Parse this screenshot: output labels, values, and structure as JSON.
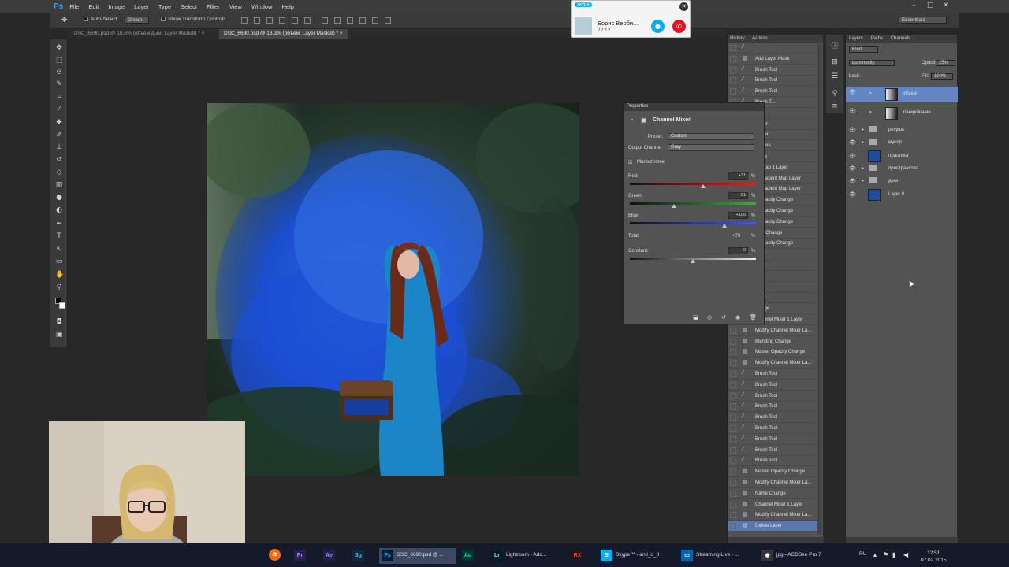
{
  "app": {
    "logo": "Ps",
    "menu": [
      "File",
      "Edit",
      "Image",
      "Layer",
      "Type",
      "Select",
      "Filter",
      "View",
      "Window",
      "Help"
    ],
    "window_controls": [
      "–",
      "□",
      "✕"
    ]
  },
  "options": {
    "auto_select_label": "Auto-Select",
    "auto_select_value": "Group",
    "show_transform_label": "Show Transform Controls",
    "workspace": "Essentials"
  },
  "tabs": [
    {
      "label": "DSC_6690.psd @ 18,6% (объем дым, Layer Mask/8) *",
      "close": "×",
      "active": false
    },
    {
      "label": "DSC_6690.psd @ 18,3% (объем, Layer Mask/8) *",
      "close": "×",
      "active": true
    }
  ],
  "skype": {
    "logo": "skype",
    "caller": "Борис Верби...",
    "duration": "22:12"
  },
  "history": {
    "tabs": [
      "History",
      "Actions"
    ],
    "items": [
      {
        "label": "",
        "icon": "brush"
      },
      {
        "label": "Add Layer Mask",
        "icon": "doc"
      },
      {
        "label": "Brush Tool",
        "icon": "brush"
      },
      {
        "label": "Brush Tool",
        "icon": "brush"
      },
      {
        "label": "Brush Tool",
        "icon": "brush"
      },
      {
        "label": "Brush T...",
        "icon": "brush"
      },
      {
        "label": "",
        "icon": "doc"
      },
      {
        "label": "...rder",
        "icon": "doc"
      },
      {
        "label": "...ayer",
        "icon": "doc"
      },
      {
        "label": "...ayers",
        "icon": "doc"
      },
      {
        "label": "...nge",
        "icon": "doc"
      },
      {
        "label": "...t Map 1 Layer",
        "icon": "doc"
      },
      {
        "label": "...Gradient Map Layer",
        "icon": "doc"
      },
      {
        "label": "...Gradient Map Layer",
        "icon": "doc"
      },
      {
        "label": "...Opacity Change",
        "icon": "doc"
      },
      {
        "label": "...Opacity Change",
        "icon": "doc"
      },
      {
        "label": "...Opacity Change",
        "icon": "doc"
      },
      {
        "label": "...ge Change",
        "icon": "doc"
      },
      {
        "label": "...Opacity Change",
        "icon": "doc"
      },
      {
        "label": "...ool",
        "icon": "brush"
      },
      {
        "label": "...ool",
        "icon": "brush"
      },
      {
        "label": "...ool",
        "icon": "brush"
      },
      {
        "label": "...ool",
        "icon": "brush"
      },
      {
        "label": "...ool",
        "icon": "brush"
      },
      {
        "label": "...ange",
        "icon": "doc"
      },
      {
        "label": "Channel Mixer 1 Layer",
        "icon": "doc"
      },
      {
        "label": "Modify Channel Mixer La...",
        "icon": "doc"
      },
      {
        "label": "Blending Change",
        "icon": "doc"
      },
      {
        "label": "Master Opacity Change",
        "icon": "doc"
      },
      {
        "label": "Modify Channel Mixer La...",
        "icon": "doc"
      },
      {
        "label": "Brush Tool",
        "icon": "brush"
      },
      {
        "label": "Brush Tool",
        "icon": "brush"
      },
      {
        "label": "Brush Tool",
        "icon": "brush"
      },
      {
        "label": "Brush Tool",
        "icon": "brush"
      },
      {
        "label": "Brush Tool",
        "icon": "brush"
      },
      {
        "label": "Brush Tool",
        "icon": "brush"
      },
      {
        "label": "Brush Tool",
        "icon": "brush"
      },
      {
        "label": "Brush Tool",
        "icon": "brush"
      },
      {
        "label": "Brush Tool",
        "icon": "brush"
      },
      {
        "label": "Master Opacity Change",
        "icon": "doc"
      },
      {
        "label": "Modify Channel Mixer La...",
        "icon": "doc"
      },
      {
        "label": "Name Change",
        "icon": "doc"
      },
      {
        "label": "Channel Mixer 1 Layer",
        "icon": "doc"
      },
      {
        "label": "Modify Channel Mixer La...",
        "icon": "doc"
      },
      {
        "label": "Delete Layer",
        "icon": "doc",
        "selected": true
      }
    ]
  },
  "layers": {
    "tabs": [
      "Layers",
      "Paths",
      "Channels"
    ],
    "filter": "Kind",
    "blend_mode": "Luminosity",
    "opacity_label": "Opacity:",
    "opacity_value": "25%",
    "lock_label": "Lock:",
    "fill_label": "Fill:",
    "fill_value": "100%",
    "items": [
      {
        "name": "объем",
        "kind": "adjust",
        "selected": true
      },
      {
        "name": "тонирование",
        "kind": "adjust"
      },
      {
        "name": "ретушь",
        "kind": "folder"
      },
      {
        "name": "мусор",
        "kind": "folder"
      },
      {
        "name": "пластика",
        "kind": "image"
      },
      {
        "name": "пространство",
        "kind": "folder"
      },
      {
        "name": "дым",
        "kind": "folder"
      },
      {
        "name": "Layer 0",
        "kind": "image"
      }
    ]
  },
  "properties": {
    "header": "Properties",
    "title": "Channel Mixer",
    "preset_label": "Preset:",
    "preset_value": "Custom",
    "output_label": "Output Channel:",
    "output_value": "Gray",
    "monochrome_label": "Monochrome",
    "sliders": [
      {
        "label": "Red:",
        "value": "+31",
        "unit": "%",
        "level": 0.58,
        "track": "red"
      },
      {
        "label": "Green:",
        "value": "-61",
        "unit": "%",
        "level": 0.35,
        "track": "green"
      },
      {
        "label": "Blue:",
        "value": "+100",
        "unit": "%",
        "level": 0.75,
        "track": "blue"
      }
    ],
    "total_label": "Total:",
    "total_value": "+70",
    "total_unit": "%",
    "constant_label": "Constant:",
    "constant_value": "0",
    "constant_unit": "%",
    "constant_level": 0.5
  },
  "taskbar": {
    "items": [
      {
        "label": "",
        "icon": "Pr",
        "color": "#9999ff",
        "bg": "#2a1f4a"
      },
      {
        "label": "",
        "icon": "Ae",
        "color": "#9999ff",
        "bg": "#1f1f4a"
      },
      {
        "label": "",
        "icon": "Sg",
        "color": "#4fc3f7",
        "bg": "#0f2b3a"
      },
      {
        "label": "DSC_6690.psd @ ...",
        "icon": "Ps",
        "color": "#31a8ff",
        "bg": "#001e36",
        "active": true
      },
      {
        "label": "",
        "icon": "Au",
        "color": "#00e4bb",
        "bg": "#00332b"
      },
      {
        "label": "Lightroom - Ado...",
        "icon": "Lr",
        "color": "#add5ec",
        "bg": "#001d26"
      },
      {
        "label": "",
        "icon": "RX",
        "color": "#ff3b3b",
        "bg": "#1a1a1a"
      },
      {
        "label": "Skype™ - anti_o_0",
        "icon": "S",
        "color": "#ffffff",
        "bg": "#00aff0"
      },
      {
        "label": "Streaming Live - ...",
        "icon": "▭",
        "color": "#ffffff",
        "bg": "#0066aa"
      },
      {
        "label": "jpg - ACDSee Pro 7",
        "icon": "◉",
        "color": "#ffffff",
        "bg": "#333333"
      }
    ],
    "lang": "RU",
    "time": "12:51",
    "date": "07.02.2015"
  }
}
